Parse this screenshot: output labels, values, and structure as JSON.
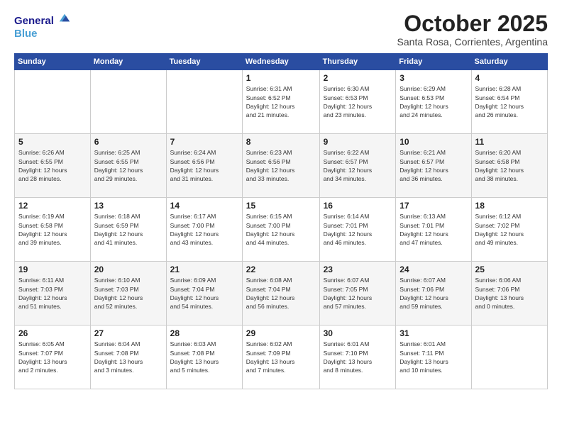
{
  "logo": {
    "line1": "General",
    "line2": "Blue"
  },
  "title": "October 2025",
  "subtitle": "Santa Rosa, Corrientes, Argentina",
  "days_header": [
    "Sunday",
    "Monday",
    "Tuesday",
    "Wednesday",
    "Thursday",
    "Friday",
    "Saturday"
  ],
  "weeks": [
    [
      {
        "day": "",
        "info": ""
      },
      {
        "day": "",
        "info": ""
      },
      {
        "day": "",
        "info": ""
      },
      {
        "day": "1",
        "info": "Sunrise: 6:31 AM\nSunset: 6:52 PM\nDaylight: 12 hours\nand 21 minutes."
      },
      {
        "day": "2",
        "info": "Sunrise: 6:30 AM\nSunset: 6:53 PM\nDaylight: 12 hours\nand 23 minutes."
      },
      {
        "day": "3",
        "info": "Sunrise: 6:29 AM\nSunset: 6:53 PM\nDaylight: 12 hours\nand 24 minutes."
      },
      {
        "day": "4",
        "info": "Sunrise: 6:28 AM\nSunset: 6:54 PM\nDaylight: 12 hours\nand 26 minutes."
      }
    ],
    [
      {
        "day": "5",
        "info": "Sunrise: 6:26 AM\nSunset: 6:55 PM\nDaylight: 12 hours\nand 28 minutes."
      },
      {
        "day": "6",
        "info": "Sunrise: 6:25 AM\nSunset: 6:55 PM\nDaylight: 12 hours\nand 29 minutes."
      },
      {
        "day": "7",
        "info": "Sunrise: 6:24 AM\nSunset: 6:56 PM\nDaylight: 12 hours\nand 31 minutes."
      },
      {
        "day": "8",
        "info": "Sunrise: 6:23 AM\nSunset: 6:56 PM\nDaylight: 12 hours\nand 33 minutes."
      },
      {
        "day": "9",
        "info": "Sunrise: 6:22 AM\nSunset: 6:57 PM\nDaylight: 12 hours\nand 34 minutes."
      },
      {
        "day": "10",
        "info": "Sunrise: 6:21 AM\nSunset: 6:57 PM\nDaylight: 12 hours\nand 36 minutes."
      },
      {
        "day": "11",
        "info": "Sunrise: 6:20 AM\nSunset: 6:58 PM\nDaylight: 12 hours\nand 38 minutes."
      }
    ],
    [
      {
        "day": "12",
        "info": "Sunrise: 6:19 AM\nSunset: 6:58 PM\nDaylight: 12 hours\nand 39 minutes."
      },
      {
        "day": "13",
        "info": "Sunrise: 6:18 AM\nSunset: 6:59 PM\nDaylight: 12 hours\nand 41 minutes."
      },
      {
        "day": "14",
        "info": "Sunrise: 6:17 AM\nSunset: 7:00 PM\nDaylight: 12 hours\nand 43 minutes."
      },
      {
        "day": "15",
        "info": "Sunrise: 6:15 AM\nSunset: 7:00 PM\nDaylight: 12 hours\nand 44 minutes."
      },
      {
        "day": "16",
        "info": "Sunrise: 6:14 AM\nSunset: 7:01 PM\nDaylight: 12 hours\nand 46 minutes."
      },
      {
        "day": "17",
        "info": "Sunrise: 6:13 AM\nSunset: 7:01 PM\nDaylight: 12 hours\nand 47 minutes."
      },
      {
        "day": "18",
        "info": "Sunrise: 6:12 AM\nSunset: 7:02 PM\nDaylight: 12 hours\nand 49 minutes."
      }
    ],
    [
      {
        "day": "19",
        "info": "Sunrise: 6:11 AM\nSunset: 7:03 PM\nDaylight: 12 hours\nand 51 minutes."
      },
      {
        "day": "20",
        "info": "Sunrise: 6:10 AM\nSunset: 7:03 PM\nDaylight: 12 hours\nand 52 minutes."
      },
      {
        "day": "21",
        "info": "Sunrise: 6:09 AM\nSunset: 7:04 PM\nDaylight: 12 hours\nand 54 minutes."
      },
      {
        "day": "22",
        "info": "Sunrise: 6:08 AM\nSunset: 7:04 PM\nDaylight: 12 hours\nand 56 minutes."
      },
      {
        "day": "23",
        "info": "Sunrise: 6:07 AM\nSunset: 7:05 PM\nDaylight: 12 hours\nand 57 minutes."
      },
      {
        "day": "24",
        "info": "Sunrise: 6:07 AM\nSunset: 7:06 PM\nDaylight: 12 hours\nand 59 minutes."
      },
      {
        "day": "25",
        "info": "Sunrise: 6:06 AM\nSunset: 7:06 PM\nDaylight: 13 hours\nand 0 minutes."
      }
    ],
    [
      {
        "day": "26",
        "info": "Sunrise: 6:05 AM\nSunset: 7:07 PM\nDaylight: 13 hours\nand 2 minutes."
      },
      {
        "day": "27",
        "info": "Sunrise: 6:04 AM\nSunset: 7:08 PM\nDaylight: 13 hours\nand 3 minutes."
      },
      {
        "day": "28",
        "info": "Sunrise: 6:03 AM\nSunset: 7:08 PM\nDaylight: 13 hours\nand 5 minutes."
      },
      {
        "day": "29",
        "info": "Sunrise: 6:02 AM\nSunset: 7:09 PM\nDaylight: 13 hours\nand 7 minutes."
      },
      {
        "day": "30",
        "info": "Sunrise: 6:01 AM\nSunset: 7:10 PM\nDaylight: 13 hours\nand 8 minutes."
      },
      {
        "day": "31",
        "info": "Sunrise: 6:01 AM\nSunset: 7:11 PM\nDaylight: 13 hours\nand 10 minutes."
      },
      {
        "day": "",
        "info": ""
      }
    ]
  ]
}
